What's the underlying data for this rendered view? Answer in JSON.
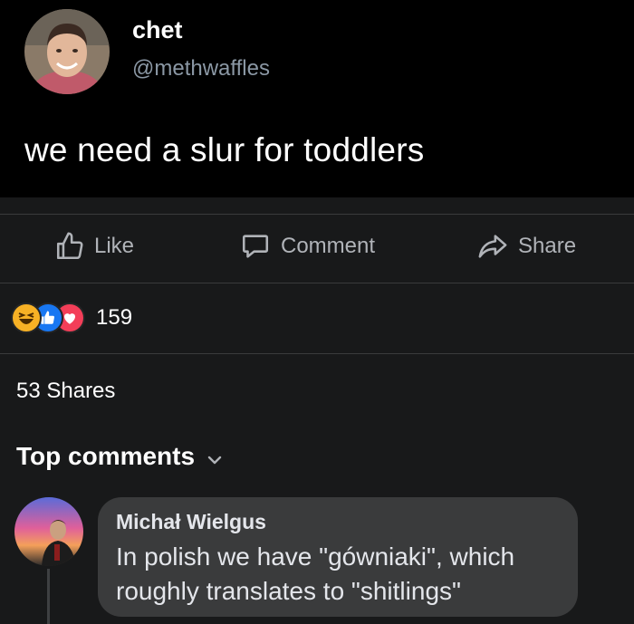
{
  "tweet": {
    "name": "chet",
    "handle": "@methwaffles",
    "text": "we need a slur for toddlers"
  },
  "actions": {
    "like": "Like",
    "comment": "Comment",
    "share": "Share"
  },
  "reactions": {
    "icons": [
      "haha-icon",
      "like-icon",
      "love-icon"
    ],
    "count": "159"
  },
  "shares_text": "53 Shares",
  "top_comments_label": "Top comments",
  "comment": {
    "author": "Michał Wielgus",
    "lines": [
      "In polish we have \"gówniaki\", which",
      "roughly translates to \"shitlings\""
    ]
  },
  "colors": {
    "tweet_bg": "#000000",
    "page_bg": "#18191a",
    "bubble_bg": "#3a3b3c",
    "like_blue": "#1877f2",
    "love_red": "#f33e58",
    "haha_yellow": "#f7b125"
  }
}
